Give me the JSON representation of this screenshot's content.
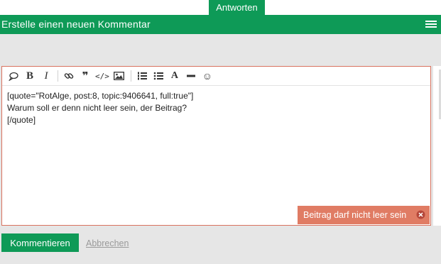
{
  "tab": {
    "label": "Antworten"
  },
  "header": {
    "title": "Erstelle einen neuen Kommentar",
    "menu_icon": "hamburger-icon"
  },
  "toolbar": {
    "buttons": [
      {
        "name": "speech-bubble-icon",
        "title": "quote"
      },
      {
        "name": "bold-icon",
        "label": "B"
      },
      {
        "name": "italic-icon",
        "label": "I"
      },
      {
        "name": "link-icon"
      },
      {
        "name": "blockquote-icon",
        "label": "❞"
      },
      {
        "name": "code-icon",
        "label": "</>"
      },
      {
        "name": "image-icon"
      },
      {
        "name": "ordered-list-icon"
      },
      {
        "name": "bullet-list-icon"
      },
      {
        "name": "font-icon",
        "label": "A"
      },
      {
        "name": "horizontal-rule-icon"
      },
      {
        "name": "emoji-icon",
        "label": "☺"
      }
    ]
  },
  "editor": {
    "content": "[quote=\"RotAlge, post:8, topic:9406641, full:true\"]\nWarum soll er denn nicht leer sein, der Beitrag?\n[/quote]"
  },
  "error": {
    "message": "Beitrag darf nicht leer sein"
  },
  "actions": {
    "submit_label": "Kommentieren",
    "cancel_label": "Abbrechen"
  },
  "colors": {
    "brand_green": "#0e9a57",
    "error_coral": "#e07c64",
    "editor_border": "#d9725f",
    "background_gray": "#e6e6e6"
  }
}
